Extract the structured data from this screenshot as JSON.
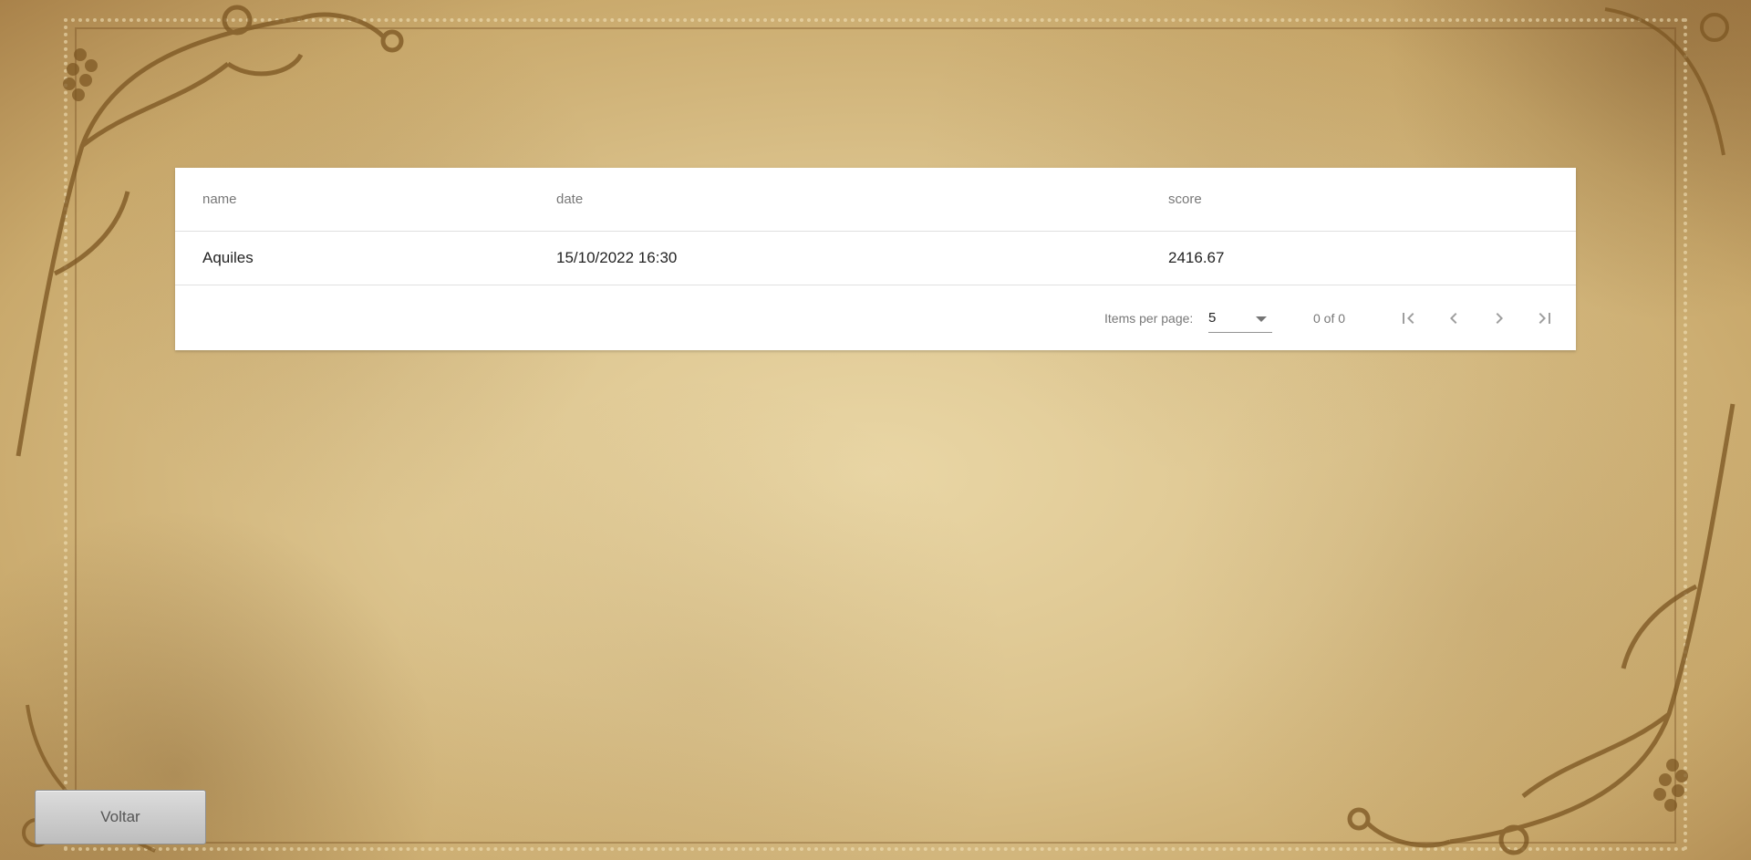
{
  "table": {
    "columns": [
      "name",
      "date",
      "score"
    ],
    "rows": [
      {
        "name": "Aquiles",
        "date": "15/10/2022 16:30",
        "score": "2416.67"
      }
    ]
  },
  "paginator": {
    "items_per_page_label": "Items per page:",
    "page_size": "5",
    "range_label": "0 of 0",
    "icons": [
      "first-page-icon",
      "chevron-left-icon",
      "chevron-right-icon",
      "last-page-icon"
    ]
  },
  "back_button": {
    "label": "Voltar"
  },
  "colors": {
    "card": "#ffffff",
    "parchment": "#dcc48e",
    "ornament": "#7a5420"
  }
}
